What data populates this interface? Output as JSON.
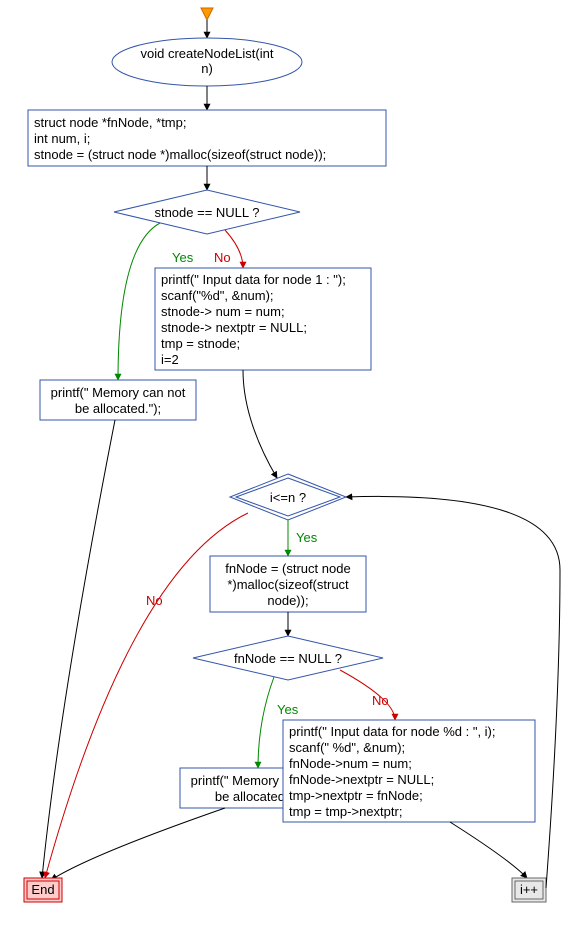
{
  "start_marker": "▼",
  "func": {
    "line1": "void createNodeList(int",
    "line2": "n)"
  },
  "decl": {
    "line1": "struct node *fnNode, *tmp;",
    "line2": "int num, i;",
    "line3": "stnode = (struct node *)malloc(sizeof(struct node));"
  },
  "cond1": "stnode == NULL ?",
  "cond1_yes": "Yes",
  "cond1_no": "No",
  "init": {
    "line1": "printf(\" Input data for node 1 : \");",
    "line2": "scanf(\"%d\", &num);",
    "line3": "stnode-> num = num;",
    "line4": "stnode-> nextptr = NULL;",
    "line5": "tmp = stnode;",
    "line6": "i=2"
  },
  "err1": {
    "line1": "printf(\" Memory can not",
    "line2": "be allocated.\");"
  },
  "cond2": "i<=n ?",
  "cond2_yes": "Yes",
  "cond2_no": "No",
  "alloc": {
    "line1": "fnNode = (struct node",
    "line2": "*)malloc(sizeof(struct",
    "line3": "node));"
  },
  "cond3": "fnNode == NULL ?",
  "cond3_yes": "Yes",
  "cond3_no": "No",
  "err2": {
    "line1": "printf(\" Memory can not",
    "line2": "be allocated.\");"
  },
  "body": {
    "line1": "printf(\" Input data for node %d : \", i);",
    "line2": "scanf(\" %d\", &num);",
    "line3": "fnNode->num = num;",
    "line4": "fnNode->nextptr = NULL;",
    "line5": "tmp->nextptr = fnNode;",
    "line6": "tmp = tmp->nextptr;"
  },
  "end": "End",
  "inc": "i++",
  "colors": {
    "start_fill": "#ff9900",
    "start_stroke": "#cc6600",
    "yes": "#008800",
    "no": "#cc0000",
    "end_stroke": "#cc0000",
    "end_fill": "#ffcccc",
    "inc_stroke": "#666666",
    "inc_fill": "#e0e0e0",
    "node_stroke": "#3355aa",
    "node_fill": "#ffffff",
    "edge": "#000000"
  }
}
